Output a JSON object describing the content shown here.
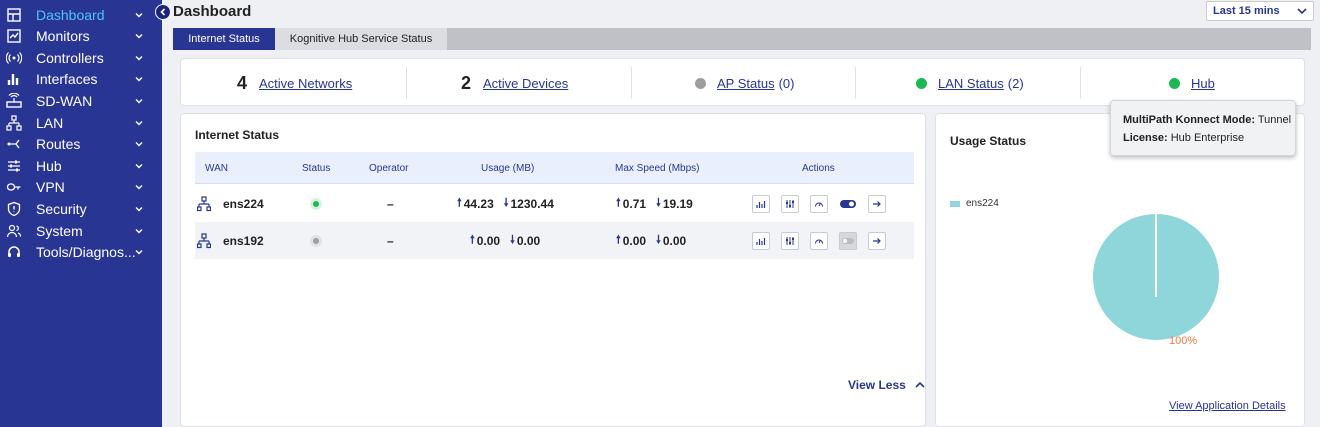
{
  "header": {
    "title": "Dashboard",
    "time_range": "Last 15 mins"
  },
  "sidebar": {
    "items": [
      {
        "label": "Dashboard",
        "icon": "dashboard-icon",
        "active": true
      },
      {
        "label": "Monitors",
        "icon": "monitor-icon"
      },
      {
        "label": "Controllers",
        "icon": "antenna-icon"
      },
      {
        "label": "Interfaces",
        "icon": "bar-chart-icon"
      },
      {
        "label": "SD-WAN",
        "icon": "router-icon"
      },
      {
        "label": "LAN",
        "icon": "network-tree-icon"
      },
      {
        "label": "Routes",
        "icon": "routes-icon"
      },
      {
        "label": "Hub",
        "icon": "sliders-icon"
      },
      {
        "label": "VPN",
        "icon": "key-icon"
      },
      {
        "label": "Security",
        "icon": "shield-icon"
      },
      {
        "label": "System",
        "icon": "users-icon"
      },
      {
        "label": "Tools/Diagnos...",
        "icon": "headset-icon"
      }
    ]
  },
  "tabs": [
    "Internet Status",
    "Kognitive Hub Service Status"
  ],
  "stats": {
    "active_networks": {
      "count": "4",
      "label": "Active Networks"
    },
    "active_devices": {
      "count": "2",
      "label": "Active Devices"
    },
    "ap_status": {
      "label": "AP Status",
      "count": "(0)",
      "color": "#9e9e9e"
    },
    "lan_status": {
      "label": "LAN Status",
      "count": "(2)",
      "color": "#1db954"
    },
    "hub": {
      "label": "Hub",
      "color": "#1db954"
    }
  },
  "internet_status": {
    "title": "Internet Status",
    "columns": [
      "WAN",
      "Status",
      "Operator",
      "Usage (MB)",
      "Max Speed (Mbps)",
      "Actions"
    ],
    "rows": [
      {
        "wan": "ens224",
        "status": "up",
        "operator": "–",
        "usage_up": "44.23",
        "usage_down": "1230.44",
        "speed_up": "0.71",
        "speed_down": "19.19",
        "toggle": "on"
      },
      {
        "wan": "ens192",
        "status": "down",
        "operator": "–",
        "usage_up": "0.00",
        "usage_down": "0.00",
        "speed_up": "0.00",
        "speed_down": "0.00",
        "toggle": "off"
      }
    ],
    "view_less": "View Less"
  },
  "usage_status": {
    "title": "Usage Status",
    "legend": [
      {
        "name": "ens224",
        "color": "#8ed6da"
      }
    ],
    "view_details": "View Application Details"
  },
  "chart_data": {
    "type": "pie",
    "categories": [
      "ens224"
    ],
    "values": [
      100
    ],
    "data_labels": [
      "100%"
    ]
  },
  "tooltip": {
    "mode_label": "MultiPath Konnect Mode:",
    "mode_value": "Tunnel",
    "license_label": "License:",
    "license_value": "Hub Enterprise"
  }
}
